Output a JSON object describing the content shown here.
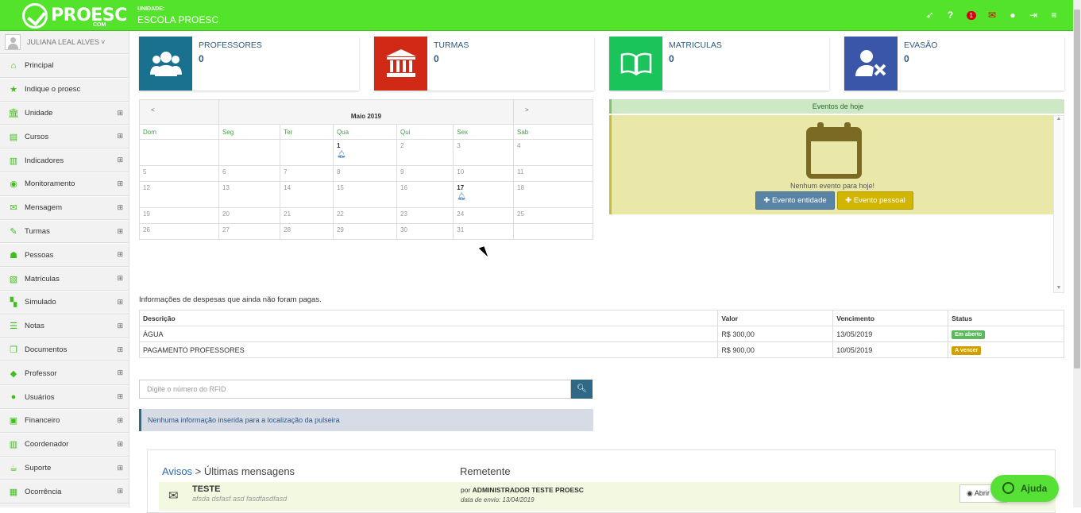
{
  "brand": {
    "logo": "PROESC",
    "logo_sub": "COM"
  },
  "header": {
    "unit_label": "UNIDADE:",
    "unit_name": "ESCOLA PROESC",
    "notification_count": "1",
    "icons": [
      "rocket-icon",
      "help-icon",
      "notification-badge",
      "mail-icon",
      "user-icon",
      "logout-icon",
      "menu-icon"
    ]
  },
  "sidebar": {
    "user": "JULIANA LEAL ALVES",
    "items": [
      {
        "label": "Principal",
        "icon": "home-icon",
        "expand": false
      },
      {
        "label": "Indique o proesc",
        "icon": "star-icon",
        "expand": false
      },
      {
        "label": "Unidade",
        "icon": "bank-icon",
        "expand": true
      },
      {
        "label": "Cursos",
        "icon": "book-icon",
        "expand": true
      },
      {
        "label": "Indicadores",
        "icon": "bar-chart-icon",
        "expand": true
      },
      {
        "label": "Monitoramento",
        "icon": "eye-icon",
        "expand": true
      },
      {
        "label": "Mensagem",
        "icon": "envelope-icon",
        "expand": true
      },
      {
        "label": "Turmas",
        "icon": "pencil-icon",
        "expand": true
      },
      {
        "label": "Pessoas",
        "icon": "users-icon",
        "expand": true
      },
      {
        "label": "Matrículas",
        "icon": "open-book-icon",
        "expand": true
      },
      {
        "label": "Simulado",
        "icon": "checker-icon",
        "expand": true
      },
      {
        "label": "Notas",
        "icon": "list-icon",
        "expand": true
      },
      {
        "label": "Documentos",
        "icon": "copy-icon",
        "expand": true
      },
      {
        "label": "Professor",
        "icon": "graduation-cap-icon",
        "expand": true
      },
      {
        "label": "Usuários",
        "icon": "user-icon",
        "expand": true
      },
      {
        "label": "Financeiro",
        "icon": "money-icon",
        "expand": true
      },
      {
        "label": "Coordenador",
        "icon": "bar-chart-icon",
        "expand": true
      },
      {
        "label": "Suporte",
        "icon": "cup-icon",
        "expand": true
      },
      {
        "label": "Ocorrência",
        "icon": "calendar-icon",
        "expand": true
      }
    ]
  },
  "stats": [
    {
      "label": "PROFESSORES",
      "value": "0",
      "color": "#1a708f",
      "icon": "users-icon"
    },
    {
      "label": "TURMAS",
      "value": "0",
      "color": "#d02a16",
      "icon": "bank-icon"
    },
    {
      "label": "MATRICULAS",
      "value": "0",
      "color": "#1bc45a",
      "icon": "open-book-icon"
    },
    {
      "label": "EVASÃO",
      "value": "0",
      "color": "#3a56a8",
      "icon": "user-remove-icon"
    }
  ],
  "calendar": {
    "prev": "<",
    "next": ">",
    "title": "Maio 2019",
    "days_of_week": [
      "Dom",
      "Seg",
      "Ter",
      "Qua",
      "Qui",
      "Sex",
      "Sab"
    ],
    "weeks": [
      [
        "",
        "",
        "",
        "1",
        "2",
        "3",
        "4"
      ],
      [
        "5",
        "6",
        "7",
        "8",
        "9",
        "10",
        "11"
      ],
      [
        "12",
        "13",
        "14",
        "15",
        "16",
        "17",
        "18"
      ],
      [
        "19",
        "20",
        "21",
        "22",
        "23",
        "24",
        "25"
      ],
      [
        "26",
        "27",
        "28",
        "29",
        "30",
        "31",
        ""
      ]
    ],
    "event_days": [
      "1",
      "17"
    ]
  },
  "events": {
    "header": "Eventos de hoje",
    "empty": "Nenhum evento para hoje!",
    "btn_entity": "Evento entidade",
    "btn_personal": "Evento pessoal"
  },
  "expenses": {
    "title": "Informações de despesas que ainda não foram pagas.",
    "columns": [
      "Descrição",
      "Valor",
      "Vencimento",
      "Status"
    ],
    "rows": [
      {
        "desc": "ÁGUA",
        "value": "R$ 300,00",
        "due": "13/05/2019",
        "status": "Em aberto",
        "status_color": "#5cb85c"
      },
      {
        "desc": "PAGAMENTO PROFESSORES",
        "value": "R$ 900,00",
        "due": "10/05/2019",
        "status": "A vencer",
        "status_color": "#d1a000"
      }
    ]
  },
  "rfid": {
    "placeholder": "Digite o número do RFID"
  },
  "bracelet": {
    "info": "Nenhuma informação inserida para a localização da pulseira"
  },
  "messages": {
    "link": "Avisos",
    "sep": " > ",
    "title": "Últimas mensagens",
    "sender_header": "Remetente",
    "items": [
      {
        "title": "TESTE",
        "snippet": "afsda dsfasf asd fasdfasdfasd",
        "by_prefix": "por",
        "by": "ADMINISTRADOR TESTE PROESC",
        "date": "data de envio: 13/04/2019",
        "action": "Abrir"
      }
    ]
  },
  "help": {
    "label": "Ajuda"
  }
}
